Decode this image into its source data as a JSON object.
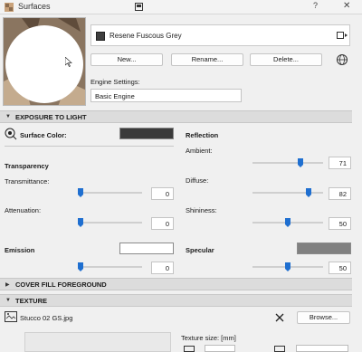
{
  "window": {
    "title": "Surfaces",
    "help": "?",
    "close": "✕"
  },
  "material": {
    "name": "Resene Fuscous Grey",
    "swatch_color": "#3f3f3f"
  },
  "buttons": {
    "new": "New...",
    "rename": "Rename...",
    "delete": "Delete..."
  },
  "engine": {
    "label": "Engine Settings:",
    "value": "Basic Engine"
  },
  "exposure": {
    "header": "EXPOSURE TO LIGHT",
    "surface_color_label": "Surface Color:",
    "surface_color": "#3a3a3a",
    "transparency_title": "Transparency",
    "transmittance_label": "Transmittance:",
    "transmittance_value": "0",
    "attenuation_label": "Attenuation:",
    "attenuation_value": "0",
    "emission_title": "Emission",
    "emission_color": "#ffffff",
    "emission_value": "0",
    "reflection_title": "Reflection",
    "ambient_label": "Ambient:",
    "ambient_value": "71",
    "diffuse_label": "Diffuse:",
    "diffuse_value": "82",
    "shininess_label": "Shininess:",
    "shininess_value": "50",
    "specular_title": "Specular",
    "specular_color": "#808080",
    "specular_value": "50"
  },
  "cover_fill": {
    "header": "COVER FILL FOREGROUND"
  },
  "texture": {
    "header": "TEXTURE",
    "file": "Stucco 02 GS.jpg",
    "browse": "Browse...",
    "size_label": "Texture size: [mm]"
  }
}
